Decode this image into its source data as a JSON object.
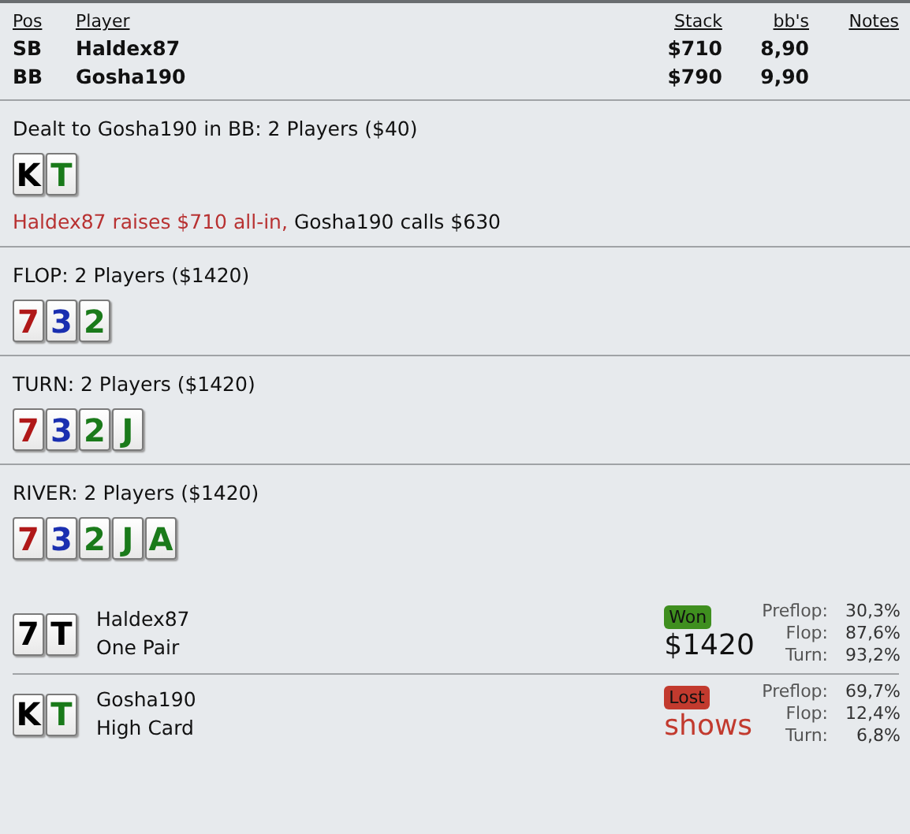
{
  "players_table": {
    "columns": [
      "Pos",
      "Player",
      "Stack",
      "bb's",
      "Notes"
    ],
    "rows": [
      {
        "pos": "SB",
        "player": "Haldex87",
        "stack": "$710",
        "bbs": "8,90"
      },
      {
        "pos": "BB",
        "player": "Gosha190",
        "stack": "$790",
        "bbs": "9,90"
      }
    ]
  },
  "streets": [
    {
      "title": "Dealt to Gosha190 in BB: 2 Players ($40)",
      "cards": [
        {
          "rank": "K",
          "color": "#000000"
        },
        {
          "rank": "T",
          "color": "#1a7a1a"
        }
      ],
      "actions": [
        {
          "kind": "raise",
          "text": "Haldex87 raises $710 all-in,"
        },
        {
          "kind": "call",
          "text": "Gosha190 calls $630"
        }
      ]
    },
    {
      "title": "FLOP: 2 Players ($1420)",
      "cards": [
        {
          "rank": "7",
          "color": "#b01818"
        },
        {
          "rank": "3",
          "color": "#1a2fb0"
        },
        {
          "rank": "2",
          "color": "#1a7a1a"
        }
      ]
    },
    {
      "title": "TURN: 2 Players ($1420)",
      "cards": [
        {
          "rank": "7",
          "color": "#b01818"
        },
        {
          "rank": "3",
          "color": "#1a2fb0"
        },
        {
          "rank": "2",
          "color": "#1a7a1a"
        },
        {
          "rank": "J",
          "color": "#1a7a1a"
        }
      ]
    },
    {
      "title": "RIVER: 2 Players ($1420)",
      "cards": [
        {
          "rank": "7",
          "color": "#b01818"
        },
        {
          "rank": "3",
          "color": "#1a2fb0"
        },
        {
          "rank": "2",
          "color": "#1a7a1a"
        },
        {
          "rank": "J",
          "color": "#1a7a1a"
        },
        {
          "rank": "A",
          "color": "#1a7a1a"
        }
      ]
    }
  ],
  "results": [
    {
      "cards": [
        {
          "rank": "7",
          "color": "#000000"
        },
        {
          "rank": "T",
          "color": "#000000"
        }
      ],
      "player": "Haldex87",
      "hand": "One Pair",
      "kind": "won",
      "badge": "Won",
      "amount": "$1420",
      "equity": [
        {
          "label": "Preflop:",
          "value": "30,3%"
        },
        {
          "label": "Flop:",
          "value": "87,6%"
        },
        {
          "label": "Turn:",
          "value": "93,2%"
        }
      ]
    },
    {
      "cards": [
        {
          "rank": "K",
          "color": "#000000"
        },
        {
          "rank": "T",
          "color": "#1a7a1a"
        }
      ],
      "player": "Gosha190",
      "hand": "High Card",
      "kind": "lost",
      "badge": "Lost",
      "amount": "shows",
      "equity": [
        {
          "label": "Preflop:",
          "value": "69,7%"
        },
        {
          "label": "Flop:",
          "value": "12,4%"
        },
        {
          "label": "Turn:",
          "value": "6,8%"
        }
      ]
    }
  ]
}
